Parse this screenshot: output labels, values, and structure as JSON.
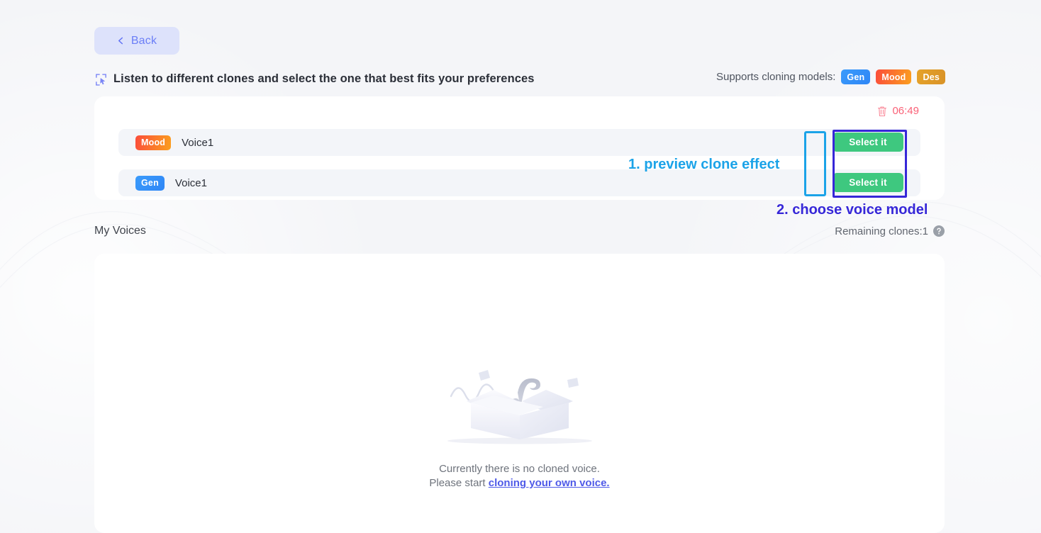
{
  "back": {
    "label": "Back",
    "icon": "chevron-left-icon"
  },
  "header": {
    "icon": "cursor-select-icon",
    "title": "Listen to different clones and select the one that best fits your preferences",
    "supports_label": "Supports cloning models:",
    "model_badges": [
      {
        "label": "Gen",
        "color": "#3a9bfb"
      },
      {
        "label": "Mood",
        "color": "#fb4d3b"
      },
      {
        "label": "Des",
        "color": "#e5a22a"
      }
    ]
  },
  "clone_card": {
    "timer": {
      "icon": "trash-icon",
      "value": "06:49",
      "color": "#fa6177"
    },
    "rows": [
      {
        "badge": "Mood",
        "name": "Voice1",
        "play_icon": "play-circle-icon",
        "select_label": "Select it"
      },
      {
        "badge": "Gen",
        "name": "Voice1",
        "play_icon": "play-circle-icon",
        "select_label": "Select it"
      }
    ],
    "select_color": "#3ec87f"
  },
  "annotations": [
    {
      "text": "1. preview clone effect",
      "color": "#1ba3e8"
    },
    {
      "text": "2. choose voice model",
      "color": "#3627d8"
    }
  ],
  "my_voices": {
    "title": "My Voices",
    "remaining_label": "Remaining clones:1",
    "help_icon": "question-mark-icon"
  },
  "empty_state": {
    "illustration": "empty-box-illustration",
    "line1": "Currently there is no cloned voice.",
    "line2_prefix": "Please start ",
    "line2_link": "cloning your own voice.",
    "link_color": "#4f5ae8"
  }
}
